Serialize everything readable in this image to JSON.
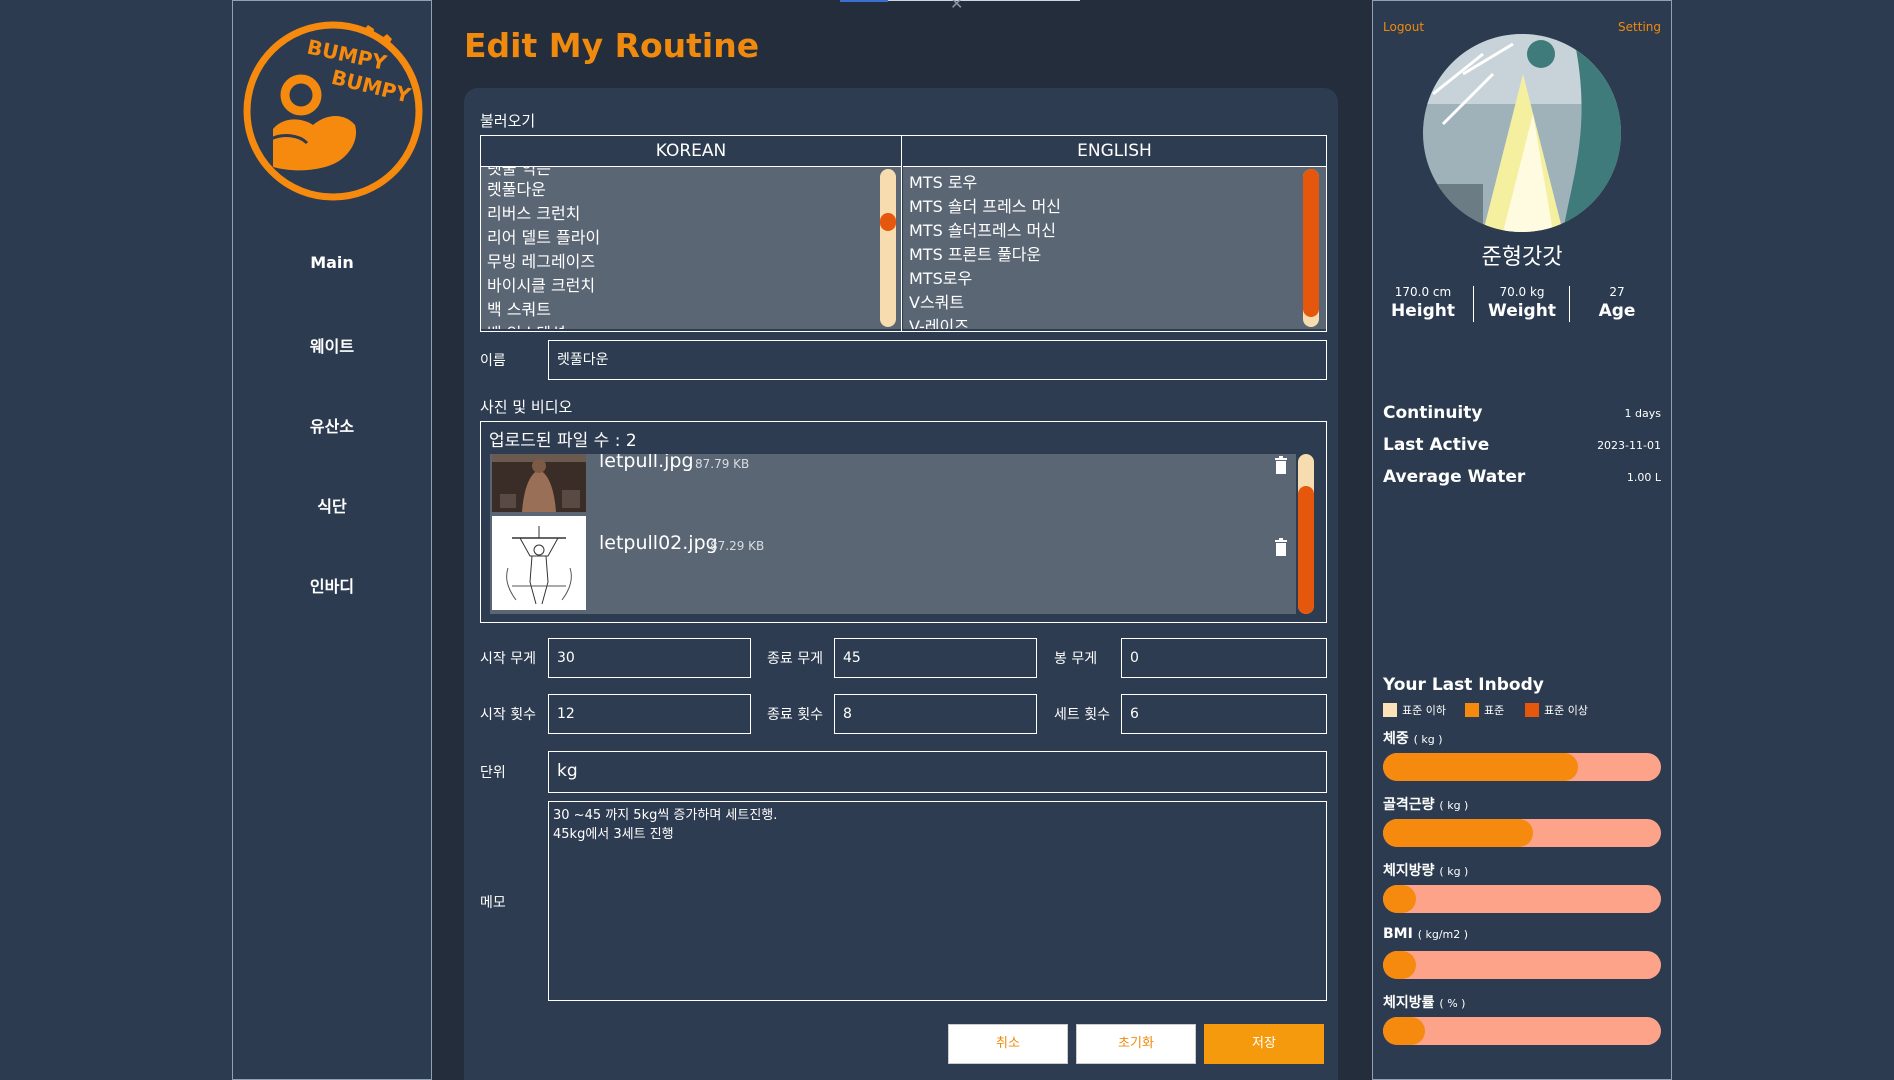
{
  "logo": {
    "line1": "BUMPY",
    "line2": "BUMPY"
  },
  "sidebar": {
    "items": [
      {
        "label": "Main"
      },
      {
        "label": "웨이트"
      },
      {
        "label": "유산소"
      },
      {
        "label": "식단"
      },
      {
        "label": "인바디"
      }
    ]
  },
  "page_title": "Edit My Routine",
  "load": {
    "label": "불러오기",
    "korean_header": "KOREAN",
    "english_header": "ENGLISH",
    "korean_items": [
      "렛풀다운",
      "리버스 크런치",
      "리어 델트 플라이",
      "무빙 레그레이즈",
      "바이시클 크런치",
      "백 스쿼트"
    ],
    "english_items": [
      "MTS 로우",
      "MTS 숄더 프레스 머신",
      "MTS 숄더프레스 머신",
      "MTS 프론트 풀다운",
      "MTS로우",
      "V스쿼트",
      "V-레이즈"
    ]
  },
  "name": {
    "label": "이름",
    "value": "렛풀다운"
  },
  "media": {
    "label": "사진 및 비디오",
    "count_text": "업로드된 파일 수 : 2",
    "files": [
      {
        "name": "letpull.jpg",
        "size": "87.79 KB"
      },
      {
        "name": "letpull02.jpg",
        "size": "87.29 KB"
      }
    ]
  },
  "fields": {
    "start_weight": {
      "label": "시작 무게",
      "value": "30"
    },
    "end_weight": {
      "label": "종료 무게",
      "value": "45"
    },
    "bar_weight": {
      "label": "봉 무게",
      "value": "0"
    },
    "start_reps": {
      "label": "시작 횟수",
      "value": "12"
    },
    "end_reps": {
      "label": "종료 횟수",
      "value": "8"
    },
    "sets": {
      "label": "세트 횟수",
      "value": "6"
    },
    "unit": {
      "label": "단위",
      "value": "kg"
    },
    "memo": {
      "label": "메모",
      "value": "30 ~45 까지 5kg씩 증가하며 세트진행.\n45kg에서 3세트 진행"
    }
  },
  "buttons": {
    "cancel": "취소",
    "reset": "초기화",
    "save": "저장"
  },
  "profile": {
    "logout": "Logout",
    "setting": "Setting",
    "username": "준형갓갓",
    "height": {
      "value": "170.0 cm",
      "label": "Height"
    },
    "weight": {
      "value": "70.0 kg",
      "label": "Weight"
    },
    "age": {
      "value": "27",
      "label": "Age"
    },
    "continuity": {
      "label": "Continuity",
      "value": "1 days"
    },
    "last_active": {
      "label": "Last Active",
      "value": "2023-11-01"
    },
    "avg_water": {
      "label": "Average Water",
      "value": "1.00 L"
    }
  },
  "inbody": {
    "title": "Your Last Inbody",
    "legend": [
      {
        "label": "표준 이하",
        "color": "#fde2b8"
      },
      {
        "label": "표준",
        "color": "#f58a0e"
      },
      {
        "label": "표준 이상",
        "color": "#e5570c"
      }
    ],
    "bars": [
      {
        "label": "체중",
        "unit": "( kg )",
        "fill": 0.7
      },
      {
        "label": "골격근량",
        "unit": "( kg )",
        "fill": 0.54
      },
      {
        "label": "체지방량",
        "unit": "( kg )",
        "fill": 0.12
      },
      {
        "label": "BMI",
        "unit": "( kg/m2 )",
        "fill": 0.12
      },
      {
        "label": "체지방률",
        "unit": "( % )",
        "fill": 0.15
      }
    ]
  },
  "colors": {
    "accent": "#f08a0e",
    "bg": "#2c3b4f",
    "scroll_track": "#f6dcae",
    "scroll_thumb": "#e5570c"
  }
}
